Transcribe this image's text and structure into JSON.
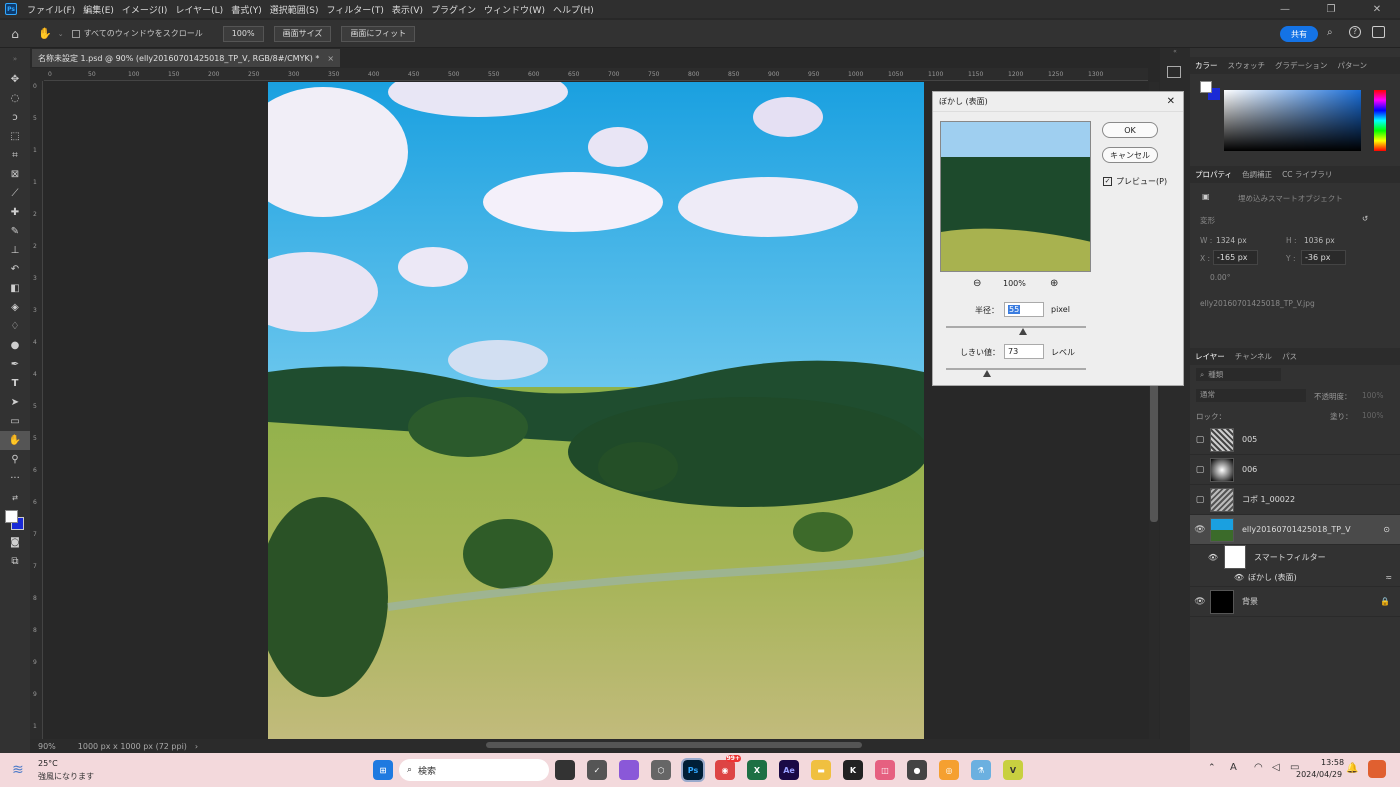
{
  "menubar": {
    "items": [
      "ファイル(F)",
      "編集(E)",
      "イメージ(I)",
      "レイヤー(L)",
      "書式(Y)",
      "選択範囲(S)",
      "フィルター(T)",
      "表示(V)",
      "プラグイン",
      "ウィンドウ(W)",
      "ヘルプ(H)"
    ],
    "logo": "Ps"
  },
  "options": {
    "scroll_all_label": "すべてのウィンドウをスクロール",
    "zoom_value": "100%",
    "fit_screen": "画面サイズ",
    "fill_screen": "画面にフィット",
    "share": "共有"
  },
  "document": {
    "tab_title": "名称未設定 1.psd @ 90% (elly20160701425018_TP_V, RGB/8#/CMYK) *",
    "close": "×"
  },
  "ruler": {
    "h": [
      "0",
      "50",
      "100",
      "150",
      "200",
      "250",
      "300",
      "350",
      "400",
      "450",
      "500",
      "550",
      "600",
      "650",
      "700",
      "750",
      "800",
      "850",
      "900",
      "950",
      "1000",
      "1050",
      "1100",
      "1150",
      "1200",
      "1250",
      "1300"
    ],
    "v": [
      "0",
      "5",
      "1",
      "1",
      "2",
      "2",
      "3",
      "3",
      "4",
      "4",
      "5",
      "5",
      "6",
      "6",
      "7",
      "7",
      "8",
      "8",
      "9",
      "9",
      "1"
    ]
  },
  "status": {
    "zoom": "90%",
    "doc_size": "1000 px x 1000 px (72 ppi)"
  },
  "dialog": {
    "title": "ぼかし (表面)",
    "ok": "OK",
    "cancel": "キャンセル",
    "preview_label": "プレビュー(P)",
    "preview_checked": true,
    "zoom": "100%",
    "radius_label": "半径：",
    "radius_value": "55",
    "radius_unit": "pixel",
    "radius_fraction": 0.55,
    "threshold_label": "しきい値：",
    "threshold_value": "73",
    "threshold_unit": "レベル",
    "threshold_fraction": 0.29
  },
  "color_panel": {
    "tabs": [
      "カラー",
      "スウォッチ",
      "グラデーション",
      "パターン"
    ],
    "fg": "#ffffff",
    "bg": "#1a2ad6"
  },
  "properties": {
    "tabs": [
      "プロパティ",
      "色調補正",
      "CC ライブラリ"
    ],
    "type": "埋め込みスマートオブジェクト",
    "section": "変形",
    "w_label": "W :",
    "w": "1324 px",
    "h_label": "H :",
    "h": "1036 px",
    "x_label": "X :",
    "x": "-165 px",
    "y_label": "Y :",
    "y": "-36 px",
    "angle": "0.00°",
    "file": "elly20160701425018_TP_V.jpg"
  },
  "layers_panel": {
    "tabs": [
      "レイヤー",
      "チャンネル",
      "パス"
    ],
    "search": "種類",
    "blend": "通常",
    "opacity_label": "不透明度：",
    "opacity": "100%",
    "lock_label": "ロック：",
    "fill_label": "塗り：",
    "fill": "100%",
    "layers": [
      {
        "name": "005",
        "visible": false
      },
      {
        "name": "006",
        "visible": false
      },
      {
        "name": "コポ 1_00022",
        "visible": false
      },
      {
        "name": "elly20160701425018_TP_V",
        "visible": true
      },
      {
        "name": "スマートフィルター",
        "visible": true
      },
      {
        "name": "ぼかし (表面)",
        "visible": true
      },
      {
        "name": "背景",
        "visible": true
      }
    ]
  },
  "taskbar": {
    "weather_temp": "25°C",
    "weather_desc": "強風になります",
    "search": "検索",
    "time": "13:58",
    "date": "2024/04/29",
    "ime": "A",
    "badge": "99+"
  }
}
